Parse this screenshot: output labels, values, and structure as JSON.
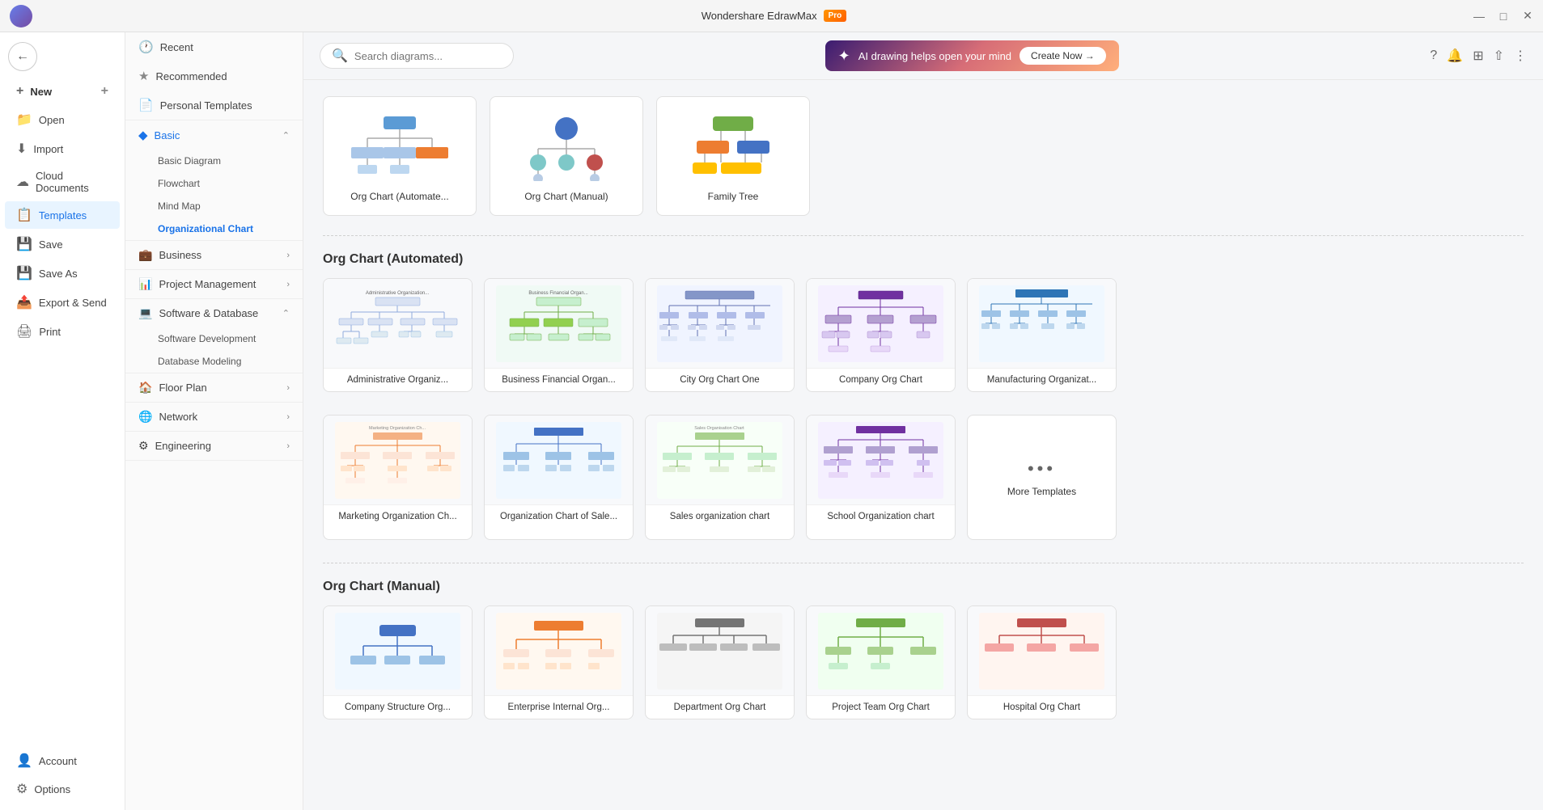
{
  "titlebar": {
    "app_name": "Wondershare EdrawMax",
    "badge": "Pro",
    "minimize": "—",
    "maximize": "□",
    "close": "✕"
  },
  "topbar": {
    "search_placeholder": "Search diagrams...",
    "ai_text": "AI drawing helps open your mind",
    "create_now": "Create Now →",
    "icons": [
      "?",
      "🔔",
      "⊞",
      "⇧",
      "⋮"
    ]
  },
  "sidebar": {
    "items": [
      {
        "id": "new",
        "label": "New",
        "icon": "+"
      },
      {
        "id": "open",
        "label": "Open",
        "icon": "📁"
      },
      {
        "id": "import",
        "label": "Import",
        "icon": "⬇"
      },
      {
        "id": "cloud",
        "label": "Cloud Documents",
        "icon": "☁"
      },
      {
        "id": "templates",
        "label": "Templates",
        "icon": "📋"
      },
      {
        "id": "save",
        "label": "Save",
        "icon": "💾"
      },
      {
        "id": "save-as",
        "label": "Save As",
        "icon": "💾"
      },
      {
        "id": "export",
        "label": "Export & Send",
        "icon": "📤"
      },
      {
        "id": "print",
        "label": "Print",
        "icon": "🖨"
      }
    ],
    "bottom_items": [
      {
        "id": "account",
        "label": "Account",
        "icon": "👤"
      },
      {
        "id": "options",
        "label": "Options",
        "icon": "⚙"
      }
    ]
  },
  "nav": {
    "top_items": [
      {
        "label": "Recent",
        "icon": "🕐"
      },
      {
        "label": "Recommended",
        "icon": "⭐"
      },
      {
        "label": "Personal Templates",
        "icon": "📄"
      }
    ],
    "categories": [
      {
        "label": "Basic",
        "icon": "◆",
        "active": true,
        "expanded": true,
        "sub_items": [
          {
            "label": "Basic Diagram",
            "active": false
          },
          {
            "label": "Flowchart",
            "active": false
          },
          {
            "label": "Mind Map",
            "active": false
          },
          {
            "label": "Organizational Chart",
            "active": true
          }
        ]
      },
      {
        "label": "Business",
        "icon": "💼",
        "expanded": false
      },
      {
        "label": "Project Management",
        "icon": "📊",
        "expanded": false
      },
      {
        "label": "Software & Database",
        "icon": "🖥",
        "expanded": true,
        "sub_items": [
          {
            "label": "Software Development"
          },
          {
            "label": "Database Modeling"
          }
        ]
      },
      {
        "label": "Floor Plan",
        "icon": "🏠",
        "expanded": false
      },
      {
        "label": "Network",
        "icon": "🌐",
        "expanded": false
      },
      {
        "label": "Engineering",
        "icon": "⚙",
        "expanded": false
      }
    ]
  },
  "featured": [
    {
      "label": "Org Chart (Automate...",
      "type": "org-auto"
    },
    {
      "label": "Org Chart (Manual)",
      "type": "org-manual"
    },
    {
      "label": "Family Tree",
      "type": "family-tree"
    }
  ],
  "sections": [
    {
      "id": "org-automated",
      "title": "Org Chart (Automated)",
      "templates": [
        {
          "label": "Administrative Organiz...",
          "type": "admin-org"
        },
        {
          "label": "Business Financial Organ...",
          "type": "biz-fin-org"
        },
        {
          "label": "City Org Chart One",
          "type": "city-org"
        },
        {
          "label": "Company Org Chart",
          "type": "company-org"
        },
        {
          "label": "Manufacturing Organizat...",
          "type": "mfg-org"
        },
        {
          "label": "Marketing Organization Ch...",
          "type": "mkt-org"
        },
        {
          "label": "Organization Chart of Sale...",
          "type": "org-sales"
        },
        {
          "label": "Sales organization chart",
          "type": "sales-org"
        },
        {
          "label": "School Organization chart",
          "type": "school-org"
        },
        {
          "label": "More Templates",
          "type": "more"
        }
      ]
    },
    {
      "id": "org-manual",
      "title": "Org Chart (Manual)",
      "templates": []
    }
  ]
}
